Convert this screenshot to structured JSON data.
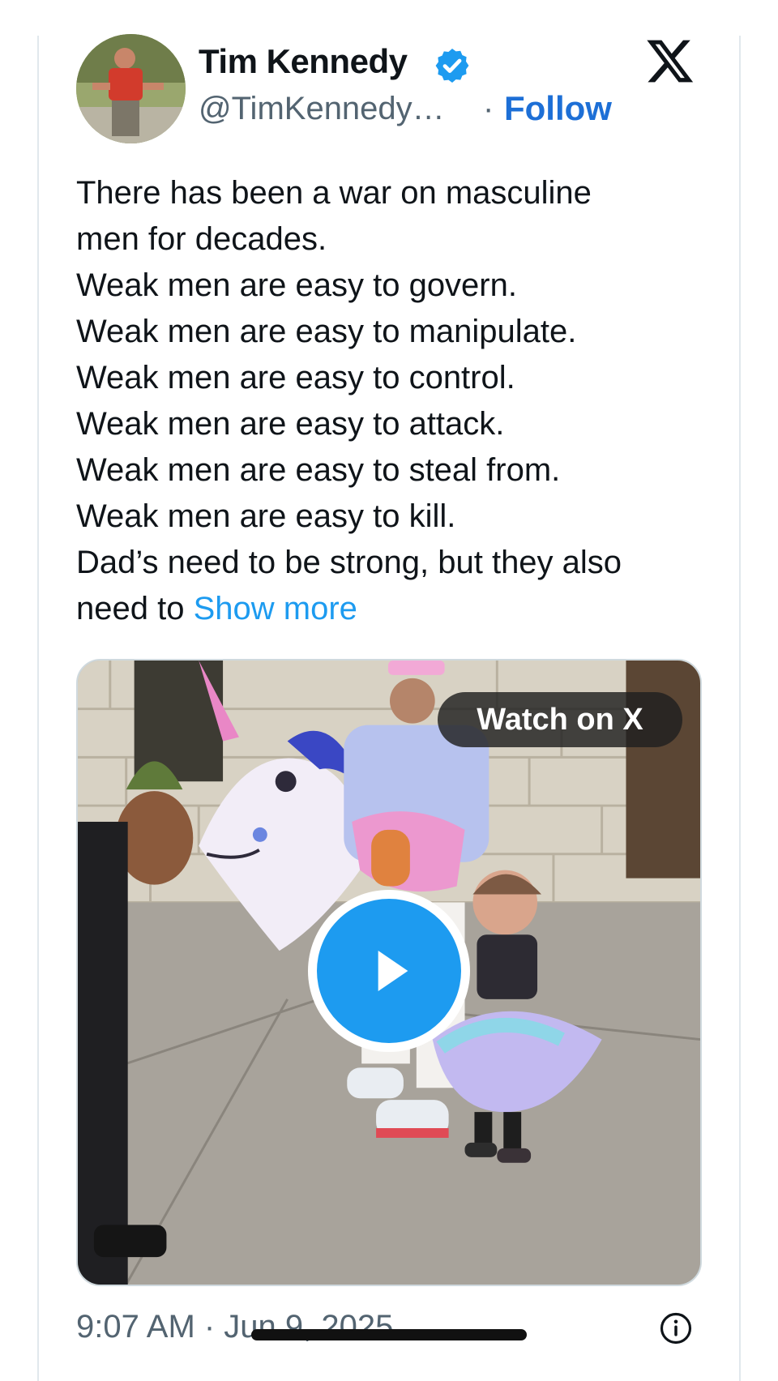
{
  "author": {
    "name": "Tim Kennedy",
    "handle": "@TimKennedy…",
    "follow_label": "Follow",
    "separator": "·",
    "verified": true
  },
  "tweet": {
    "lines": [
      "There has been a war on masculine",
      "men for decades.",
      "Weak men are easy to govern.",
      "Weak men are easy to manipulate.",
      "Weak men are easy to control.",
      "Weak men are easy to attack.",
      "Weak men are easy to steal from.",
      "Weak men are easy to kill.",
      "Dad’s need to be strong, but they also"
    ],
    "last_line_prefix": "need to ",
    "show_more_label": "Show more"
  },
  "media": {
    "watch_label": "Watch on X",
    "play_icon": "play-icon"
  },
  "footer": {
    "timestamp": "9:07 AM · Jun 9, 2025",
    "info_icon": "info-icon"
  },
  "colors": {
    "link": "#1d9bf0",
    "follow": "#1d6fd6",
    "verified": "#1d9bf0",
    "text": "#0f1419",
    "muted": "#536471"
  }
}
